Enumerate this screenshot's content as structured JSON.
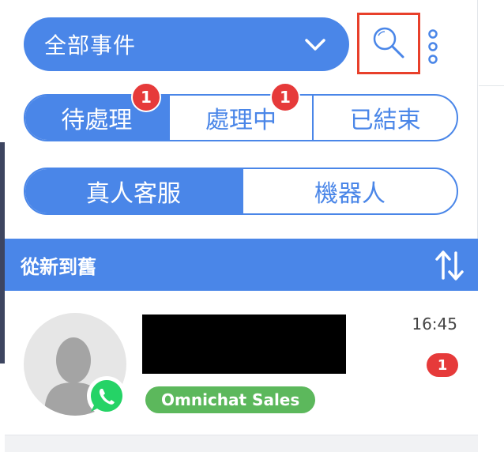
{
  "filter": {
    "selected": "全部事件"
  },
  "status_tabs": [
    {
      "label": "待處理",
      "badge": "1",
      "active": true
    },
    {
      "label": "處理中",
      "badge": "1",
      "active": false
    },
    {
      "label": "已結束",
      "badge": "",
      "active": false
    }
  ],
  "agent_tabs": [
    {
      "label": "真人客服",
      "active": true
    },
    {
      "label": "機器人",
      "active": false
    }
  ],
  "sort": {
    "label": "從新到舊"
  },
  "conversations": [
    {
      "time": "16:45",
      "unread": "1",
      "tag": "Omnichat Sales",
      "channel_icon": "whatsapp-icon"
    }
  ],
  "colors": {
    "accent": "#4a86e8",
    "badge": "#e63a3a",
    "tag": "#5cb85c",
    "highlight": "#e8402b",
    "whatsapp": "#25d366"
  }
}
